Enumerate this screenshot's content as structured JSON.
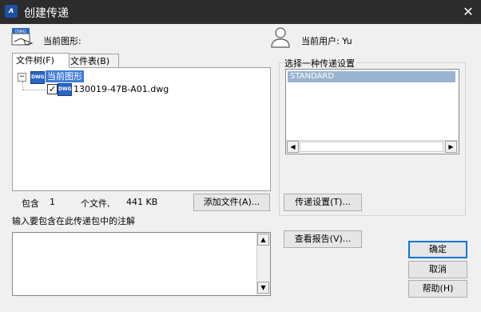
{
  "window": {
    "title": "创建传递",
    "icon": "app-logo-icon",
    "close_symbol": "✕"
  },
  "header": {
    "drawing_label": "当前图形:",
    "user_label": "当前用户: Yu"
  },
  "tabs": [
    {
      "label": "文件树(F)",
      "active": true
    },
    {
      "label": "文件表(B)",
      "active": false
    }
  ],
  "tree": {
    "root": {
      "label": "当前图形",
      "expanded": true
    },
    "children": [
      {
        "label": "130019-47B-A01.dwg",
        "checked": true
      }
    ]
  },
  "summary": {
    "contains_label": "包含",
    "count": "1",
    "files_label": "个文件,",
    "size": "441 KB"
  },
  "buttons": {
    "add_file": "添加文件(A)...",
    "transmittal_setup": "传递设置(T)...",
    "view_report": "查看报告(V)...",
    "ok": "确定",
    "cancel": "取消",
    "help": "帮助(H)"
  },
  "setup_group": {
    "label": "选择一种传递设置",
    "items": [
      {
        "label": "STANDARD",
        "selected": true
      }
    ]
  },
  "notes": {
    "label": "输入要包含在此传递包中的注解",
    "value": ""
  },
  "colors": {
    "titlebar": "#2c2c2c",
    "selection": "#3d7bd9",
    "list_selection": "#99b4d1"
  }
}
